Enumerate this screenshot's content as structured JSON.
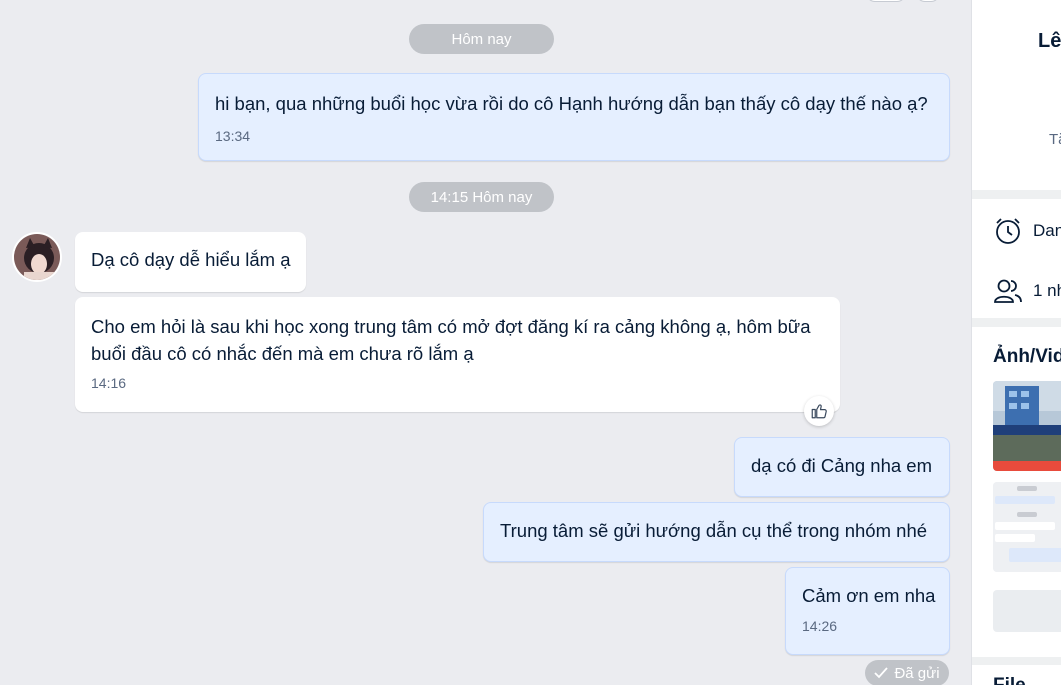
{
  "chat": {
    "date_divider_1": "Hôm nay",
    "date_divider_2": "14:15 Hôm nay",
    "messages": [
      {
        "direction": "out",
        "text": "hi bạn, qua những buổi học vừa rồi do cô Hạnh hướng dẫn bạn thấy cô dạy thế nào ạ?",
        "time": "13:34"
      },
      {
        "direction": "in",
        "text": "Dạ cô dạy dễ hiểu lắm ạ",
        "time": ""
      },
      {
        "direction": "in",
        "text": "Cho em hỏi là sau khi học xong trung tâm có mở đợt đăng kí ra cảng không ạ, hôm bữa buổi đầu cô có nhắc đến mà em chưa rõ lắm ạ",
        "time": "14:16"
      },
      {
        "direction": "out",
        "text": "dạ có đi Cảng nha em",
        "time": ""
      },
      {
        "direction": "out",
        "text": "Trung tâm sẽ gửi hướng dẫn cụ thể trong nhóm nhé",
        "time": ""
      },
      {
        "direction": "out",
        "text": "Cảm ơn em nha",
        "time": "14:26"
      }
    ],
    "status": "Đã gửi"
  },
  "panel": {
    "name": "Lê",
    "sub": "Tắ",
    "reminder": "Dan",
    "members": "1 nh",
    "media_title": "Ảnh/Vid",
    "files_title": "File"
  },
  "colors": {
    "background": "#ebecf0",
    "outgoing_bubble": "#e5efff",
    "incoming_bubble": "#ffffff",
    "pill": "#c0c3c8"
  }
}
